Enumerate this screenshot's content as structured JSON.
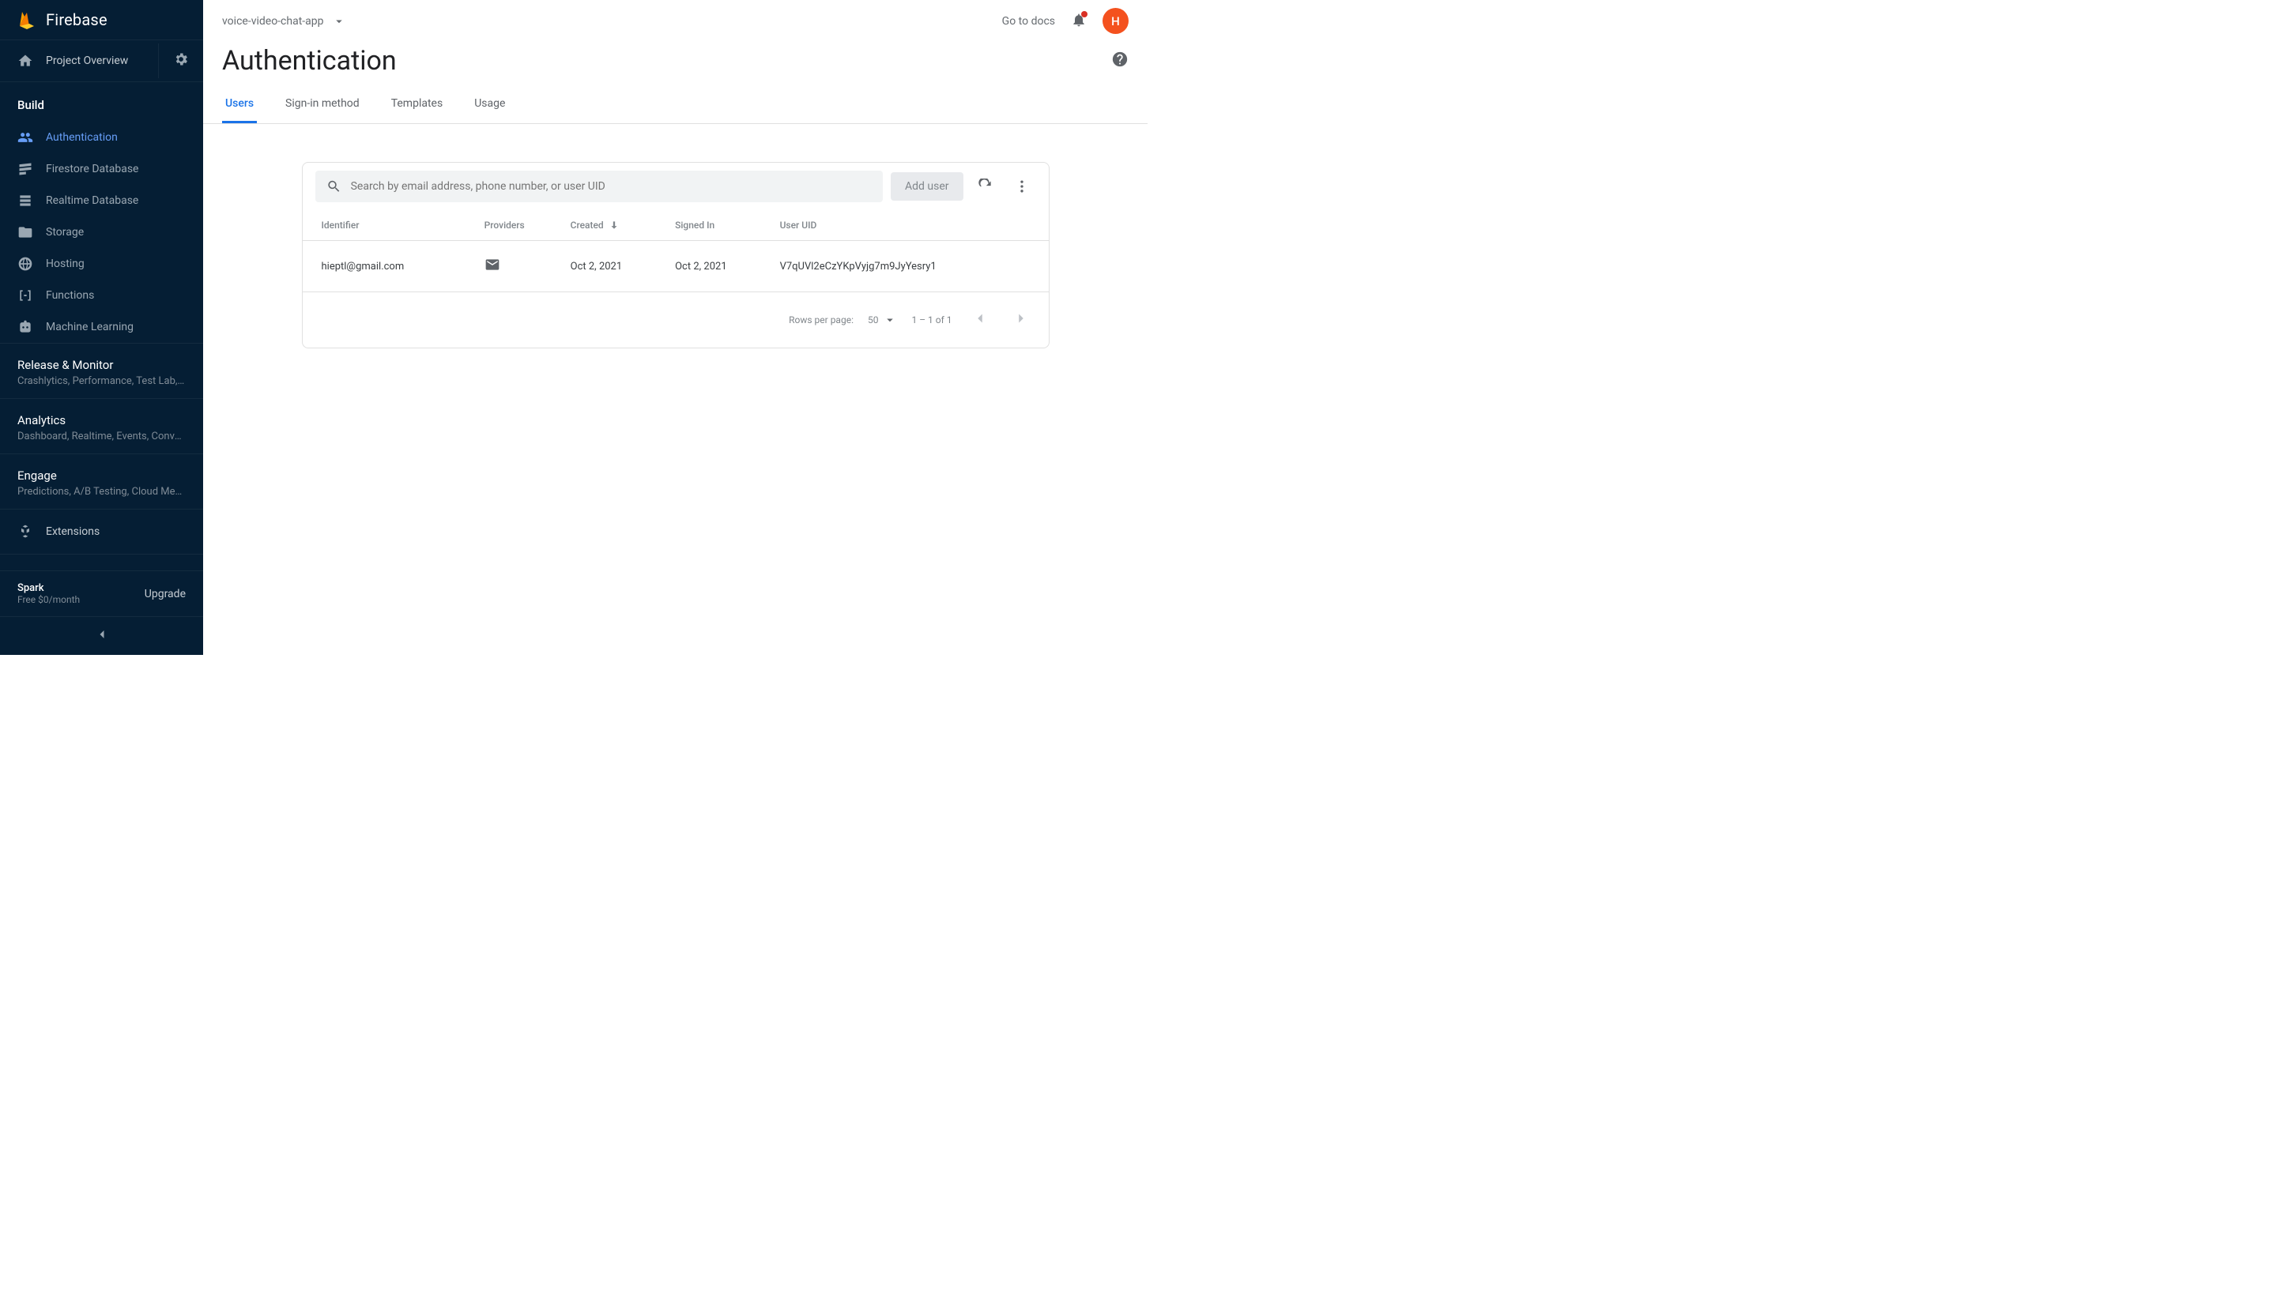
{
  "brand": "Firebase",
  "sidebar": {
    "overview": "Project Overview",
    "build": {
      "heading": "Build",
      "items": [
        {
          "label": "Authentication"
        },
        {
          "label": "Firestore Database"
        },
        {
          "label": "Realtime Database"
        },
        {
          "label": "Storage"
        },
        {
          "label": "Hosting"
        },
        {
          "label": "Functions"
        },
        {
          "label": "Machine Learning"
        }
      ]
    },
    "groups": [
      {
        "title": "Release & Monitor",
        "sub": "Crashlytics, Performance, Test Lab, ..."
      },
      {
        "title": "Analytics",
        "sub": "Dashboard, Realtime, Events, Conve..."
      },
      {
        "title": "Engage",
        "sub": "Predictions, A/B Testing, Cloud Mes..."
      }
    ],
    "extensions": "Extensions",
    "plan": {
      "name": "Spark",
      "price": "Free $0/month",
      "upgrade": "Upgrade"
    }
  },
  "topbar": {
    "project": "voice-video-chat-app",
    "docs": "Go to docs",
    "avatar_initial": "H"
  },
  "page": {
    "title": "Authentication",
    "tabs": [
      "Users",
      "Sign-in method",
      "Templates",
      "Usage"
    ],
    "active_tab": 0
  },
  "users": {
    "search_placeholder": "Search by email address, phone number, or user UID",
    "add_button": "Add user",
    "columns": [
      "Identifier",
      "Providers",
      "Created",
      "Signed In",
      "User UID"
    ],
    "rows": [
      {
        "identifier": "hieptl@gmail.com",
        "provider": "email",
        "created": "Oct 2, 2021",
        "signed_in": "Oct 2, 2021",
        "uid": "V7qUVl2eCzYKpVyjg7m9JyYesry1"
      }
    ],
    "footer": {
      "rows_per_page_label": "Rows per page:",
      "rows_per_page_value": "50",
      "range": "1 – 1 of 1"
    }
  }
}
